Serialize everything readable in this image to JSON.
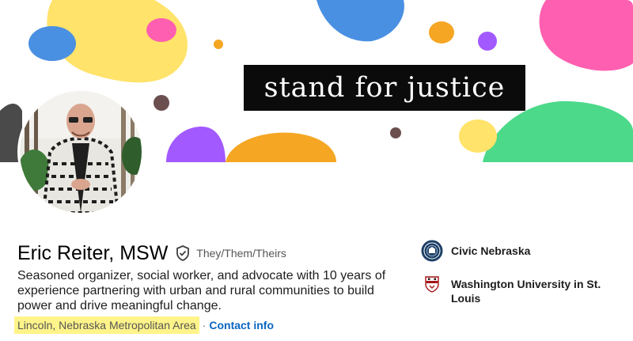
{
  "banner": {
    "tagline": "stand for justice"
  },
  "profile": {
    "name": "Eric Reiter, MSW",
    "pronouns": "They/Them/Theirs",
    "headline": "Seasoned organizer, social worker, and advocate with 10 years of experience partnering with urban and rural communities to build power and drive meaningful change.",
    "location": "Lincoln, Nebraska Metropolitan Area",
    "separator": "·",
    "contact_label": "Contact info"
  },
  "organizations": [
    {
      "name": "Civic Nebraska",
      "logo_icon": "civic-nebraska-logo-icon"
    },
    {
      "name": "Washington University in St. Louis",
      "logo_icon": "washu-shield-icon"
    }
  ],
  "colors": {
    "accent_link": "#0a66c2",
    "location_highlight": "#fff48a",
    "banner_blobs": [
      "#ffe36a",
      "#4a90e2",
      "#ff5fb0",
      "#a259ff",
      "#f5a623",
      "#4cd98a",
      "#6b4f4f"
    ]
  }
}
